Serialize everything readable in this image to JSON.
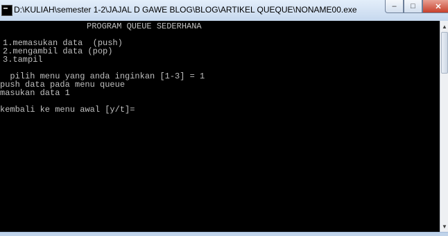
{
  "window": {
    "title": "D:\\KULIAH\\semester 1-2\\JAJAL D GAWE BLOG\\BLOG\\ARTIKEL QUEQUE\\NONAME00.exe",
    "icons": {
      "app": "console-app-icon",
      "minimize": "minimize-icon",
      "maximize": "maximize-icon",
      "close": "close-icon"
    },
    "glyphs": {
      "minimize": "–",
      "maximize": "□",
      "close": "✕"
    }
  },
  "console": {
    "lines": [
      "PROGRAM QUEUE SEDERHANA",
      "1.memasukan data  (push)",
      "2.mengambil data (pop)",
      "3.tampil",
      "  pilih menu yang anda inginkan [1-3] = 1",
      "push data pada menu queue",
      "masukan data 1",
      "kembali ke menu awal [y/t]="
    ]
  },
  "scrollbar": {
    "up_glyph": "▲",
    "down_glyph": "▼"
  }
}
